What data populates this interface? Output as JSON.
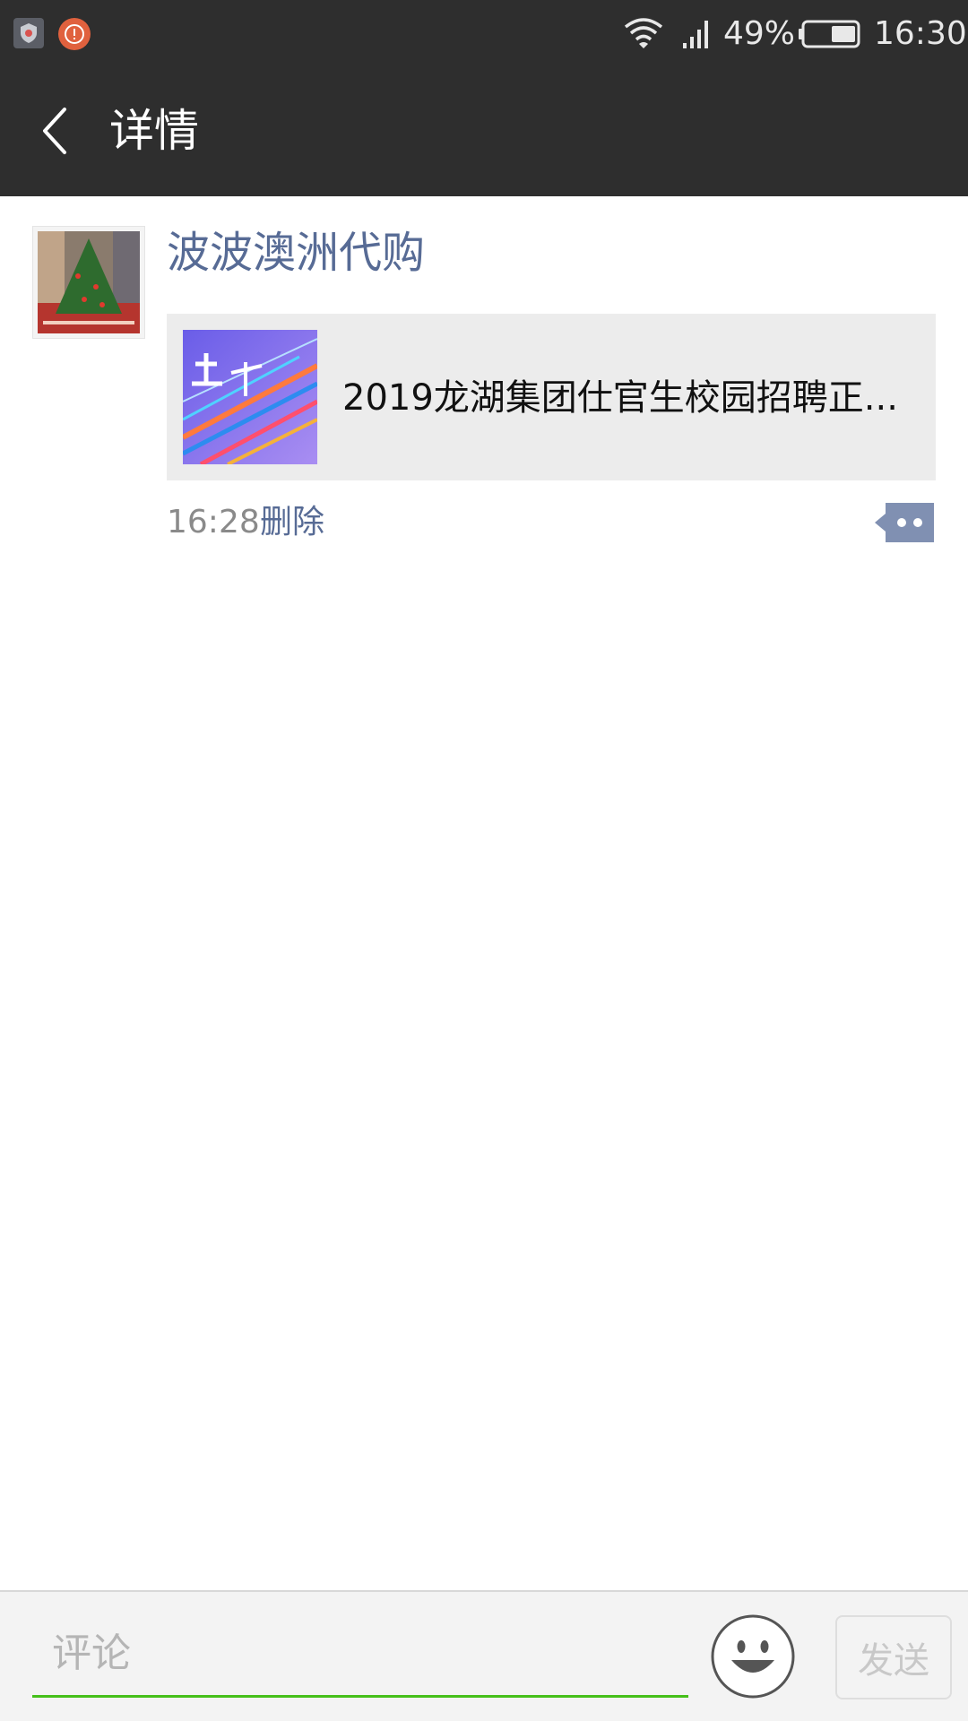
{
  "status_bar": {
    "battery_percent": "49%",
    "time": "16:30",
    "icons": [
      "shield-icon",
      "alert-icon",
      "wifi-icon",
      "signal-icon",
      "battery-icon"
    ]
  },
  "nav": {
    "title": "详情",
    "back_icon": "chevron-left-icon"
  },
  "post": {
    "author": "波波澳洲代购",
    "link_title": "2019龙湖集团仕官生校园招聘正...",
    "time": "16:28",
    "delete_label": "删除",
    "more_icon": "comment-dots-icon"
  },
  "comment_bar": {
    "placeholder": "评论",
    "value": "",
    "emoji_icon": "smiley-icon",
    "send_label": "发送"
  },
  "colors": {
    "header_bg": "#2e2e2e",
    "link_blue": "#576b95",
    "input_accent": "#45c01a",
    "card_bg": "#ececec"
  }
}
